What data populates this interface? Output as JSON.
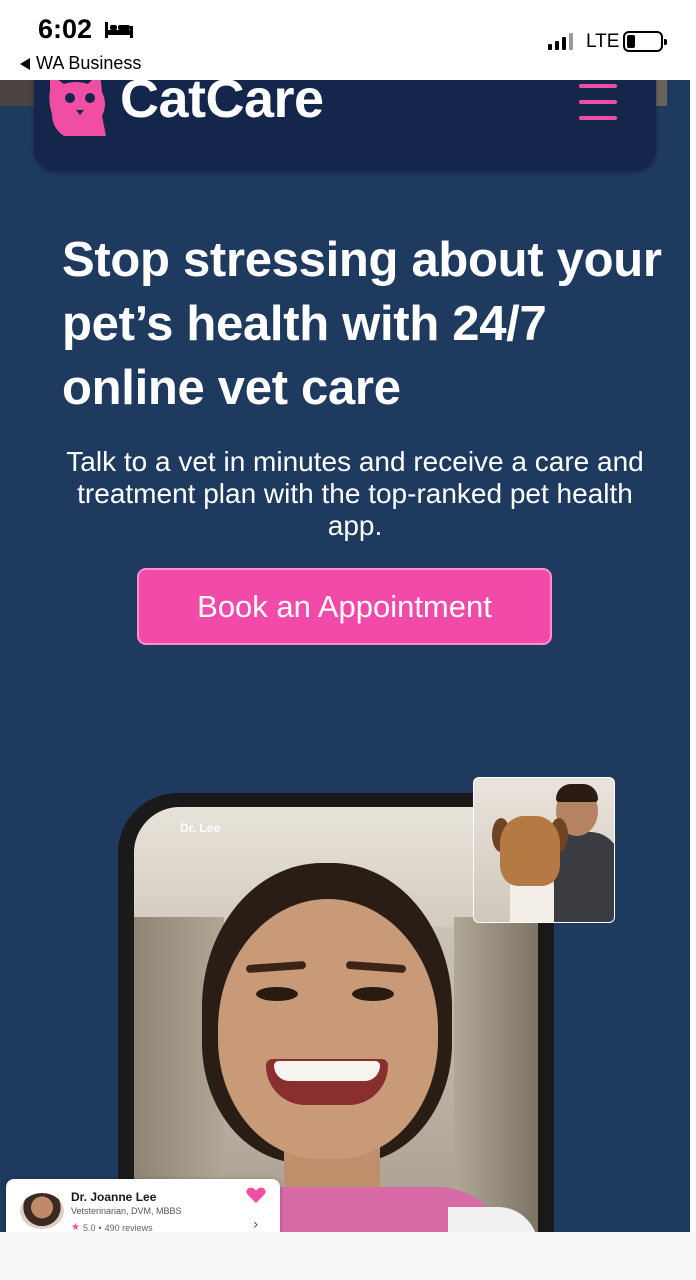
{
  "status_bar": {
    "time": "6:02",
    "back_app": "WA Business",
    "network": "LTE"
  },
  "header": {
    "logo_text": "CatCare",
    "logo_icon": "cat-icon",
    "menu_icon": "hamburger-icon"
  },
  "hero": {
    "title": "Stop stressing about your pet’s health with 24/7 online vet care",
    "subtitle": "Talk to a vet in minutes and receive a care and treatment plan with the top-ranked pet health app.",
    "cta_label": "Book an Appointment"
  },
  "call": {
    "caller_label": "Dr. Lee"
  },
  "doctor_card": {
    "name": "Dr. Joanne Lee",
    "credentials": "Vetsterinarian, DVM, MBBS",
    "rating": "5.0",
    "separator": "•",
    "reviews": "490 reviews",
    "favorite_icon": "heart-icon",
    "chevron_icon": "chevron-right-icon"
  },
  "colors": {
    "background": "#1f3a5f",
    "navbar": "#14264c",
    "accent": "#f24aa8",
    "text": "#ffffff"
  }
}
